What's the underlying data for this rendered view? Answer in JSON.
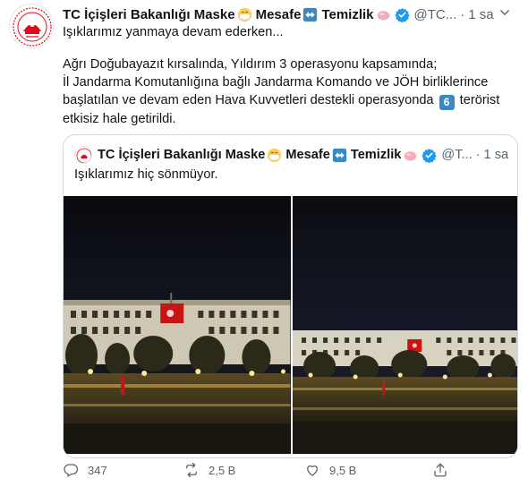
{
  "author": {
    "name": "TC İçişleri Bakanlığı Maske",
    "name_part2": "Mesafe",
    "name_part3": "Temizlik",
    "handle": "@TC...",
    "dot": "·",
    "time": "1 sa"
  },
  "tweet": {
    "line1": "Işıklarımız yanmaya devam ederken...",
    "line2": "Ağrı Doğubayazıt kırsalında, Yıldırım 3 operasyonu kapsamında;",
    "line3": "İl Jandarma Komutanlığına bağlı Jandarma Komando ve JÖH birliklerince",
    "line4a": "başlatılan ve devam eden Hava Kuvvetleri destekli operasyonda",
    "number": "6",
    "line4b": "terörist",
    "line5": "etkisiz hale getirildi."
  },
  "quote": {
    "name": "TC İçişleri Bakanlığı Maske",
    "name_part2": "Mesafe",
    "name_part3": "Temizlik",
    "handle": "@T...",
    "dot": "·",
    "time": "1 sa",
    "text": "Işıklarımız hiç sönmüyor."
  },
  "actions": {
    "reply_count": "347",
    "retweet_count": "2,5 B",
    "like_count": "9,5 B"
  },
  "colors": {
    "verified": "#1d9bf0",
    "muted": "#536471",
    "border": "#cfd9de",
    "emblem_red": "#e30a17"
  }
}
